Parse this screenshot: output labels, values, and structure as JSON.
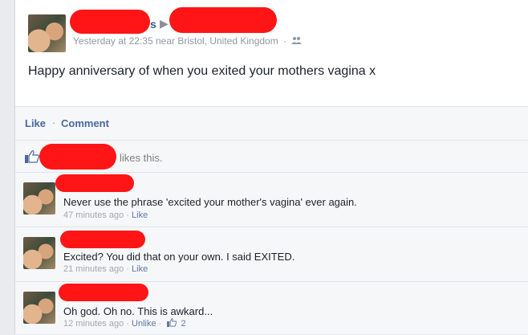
{
  "post": {
    "author_suffix": "s",
    "meta_time": "Yesterday at 22:35",
    "meta_location": "near Bristol, United Kingdom",
    "meta_dot": "·",
    "message": "Happy anniversary of when you exited your mothers vagina x"
  },
  "actions": {
    "like_label": "Like",
    "separator": "·",
    "comment_label": "Comment"
  },
  "likes": {
    "text": "likes this."
  },
  "comments": [
    {
      "text": "Never use the phrase 'excited your mother's vagina' ever again.",
      "time": "47 minutes ago",
      "sep": "·",
      "action": "Like"
    },
    {
      "text": "Excited? You did that on your own. I said EXITED.",
      "time": "21 minutes ago",
      "sep": "·",
      "action": "Like"
    },
    {
      "text": "Oh god. Oh no. This is awkard...",
      "time": "12 minutes ago",
      "sep": "·",
      "action": "Unlike",
      "sep2": "·",
      "like_count": "2"
    }
  ],
  "colors": {
    "link": "#4b67a1",
    "redaction": "#ff1515",
    "background": "#e9ebee"
  }
}
